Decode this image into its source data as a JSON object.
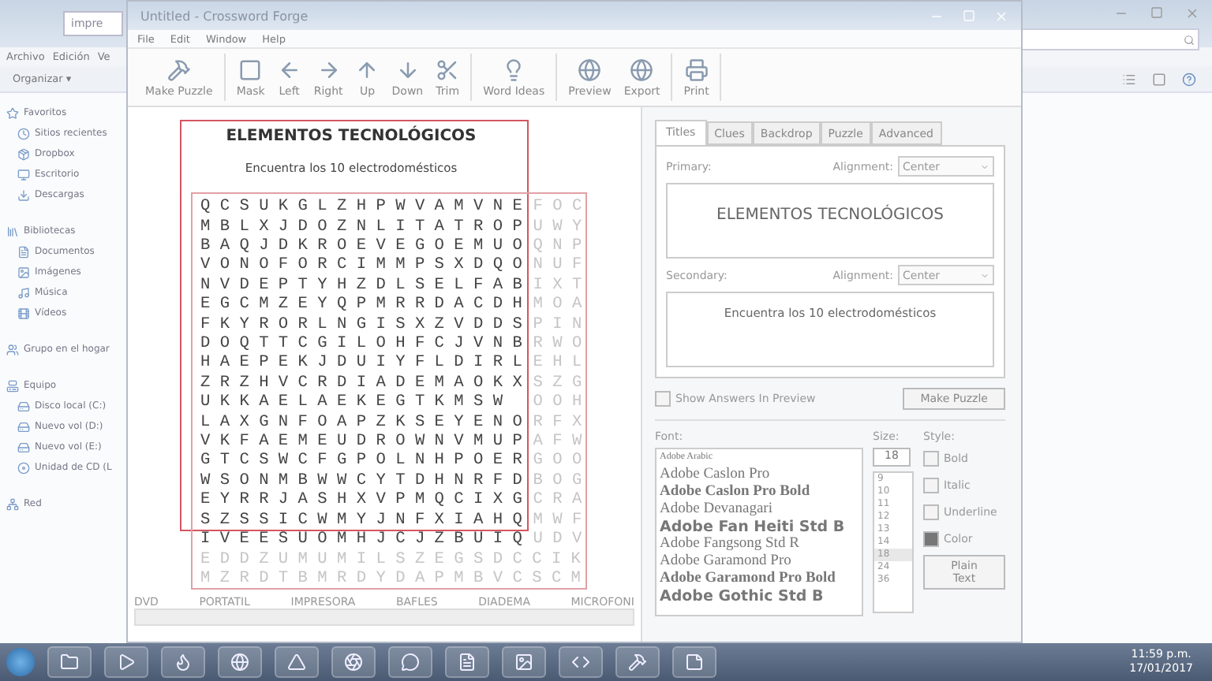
{
  "explorer": {
    "address": "impre",
    "menu": [
      "Archivo",
      "Edición",
      "Ve"
    ],
    "organize": "Organizar ▾",
    "sidebar": [
      {
        "kind": "star",
        "label": "Favoritos",
        "children": [
          {
            "kind": "clock",
            "label": "Sitios recientes"
          },
          {
            "kind": "box",
            "label": "Dropbox"
          },
          {
            "kind": "monitor",
            "label": "Escritorio"
          },
          {
            "kind": "download",
            "label": "Descargas"
          }
        ]
      },
      {
        "kind": "library",
        "label": "Bibliotecas",
        "children": [
          {
            "kind": "doc",
            "label": "Documentos"
          },
          {
            "kind": "image",
            "label": "Imágenes"
          },
          {
            "kind": "music",
            "label": "Música"
          },
          {
            "kind": "film",
            "label": "Vídeos"
          }
        ]
      },
      {
        "kind": "users",
        "label": "Grupo en el hogar"
      },
      {
        "kind": "computer",
        "label": "Equipo",
        "children": [
          {
            "kind": "drive",
            "label": "Disco local (C:)"
          },
          {
            "kind": "drive",
            "label": "Nuevo vol (D:)"
          },
          {
            "kind": "drive",
            "label": "Nuevo vol (E:)"
          },
          {
            "kind": "disc",
            "label": "Unidad de CD (L"
          }
        ]
      },
      {
        "kind": "network",
        "label": "Red"
      }
    ]
  },
  "window": {
    "title": "Untitled - Crossword Forge",
    "menu": [
      "File",
      "Edit",
      "Window",
      "Help"
    ],
    "toolbar": [
      [
        {
          "kind": "anvil",
          "label": "Make Puzzle"
        }
      ],
      [
        {
          "kind": "mask",
          "label": "Mask"
        },
        {
          "kind": "left",
          "label": "Left"
        },
        {
          "kind": "right",
          "label": "Right"
        },
        {
          "kind": "up",
          "label": "Up"
        },
        {
          "kind": "down",
          "label": "Down"
        },
        {
          "kind": "trim",
          "label": "Trim"
        }
      ],
      [
        {
          "kind": "bulb",
          "label": "Word Ideas"
        }
      ],
      [
        {
          "kind": "globe",
          "label": "Preview"
        },
        {
          "kind": "globe",
          "label": "Export"
        }
      ],
      [
        {
          "kind": "printer",
          "label": "Print"
        }
      ]
    ]
  },
  "puzzle": {
    "title": "ELEMENTOS TECNOLÓGICOS",
    "subtitle": "Encuentra los 10 electrodomésticos",
    "rows": [
      {
        "inside": "Q C S U K G L Z H P W V A M V N E",
        "outside": "F O C"
      },
      {
        "inside": "M B L X J D O Z N L I T A T R O P",
        "outside": "U W Y"
      },
      {
        "inside": "B A Q J D K R O E V E G O E M U O",
        "outside": "Q N P"
      },
      {
        "inside": "V O N O F O R C I M M P S X D Q O",
        "outside": "N U F"
      },
      {
        "inside": "N V D E P T Y H Z D L S E L F A B",
        "outside": "I X T"
      },
      {
        "inside": "E G C M Z E Y Q P M R R D A C D H",
        "outside": "M O A"
      },
      {
        "inside": "F K Y R O R L N G I S X Z V D D S",
        "outside": "P I N"
      },
      {
        "inside": "D O Q T T C G I L O H F C J V N B",
        "outside": "R W O"
      },
      {
        "inside": "H A E P E K J D U I Y F L D I R L",
        "outside": "E H L"
      },
      {
        "inside": "Z R Z H V C R D I A D E M A O K X",
        "outside": "S Z G"
      },
      {
        "inside": "U K K A E L A E K E G T K M S W",
        "outside": "O O H"
      },
      {
        "inside": "L A X G N F O A P Z K S E Y E N O",
        "outside": "R F X"
      },
      {
        "inside": "V K F A E M E U D R O W N V M U P",
        "outside": "A F W"
      },
      {
        "inside": "G T C S W C F G P O L N H P O E R",
        "outside": "G O O"
      },
      {
        "inside": "W S O N M B W W C Y T D H N R F D",
        "outside": "B O G"
      },
      {
        "inside": "E Y R R J A S H X V P M Q C I X G",
        "outside": "C R A"
      },
      {
        "inside": "S Z S S I C W M Y J N F X I A H Q",
        "outside": "M W F"
      },
      {
        "inside": "I V E E S U O M H J C J Z B U I Q",
        "outside": "U D V"
      }
    ],
    "outer_rows": [
      "E D D Z U M U M I L S Z E G S D C C I K",
      "M Z R D T B M R D Y D A P M B V C S C M"
    ],
    "words": [
      "DVD",
      "PORTATIL",
      "IMPRESORA",
      "BAFLES",
      "DIADEMA",
      "MICROFONI"
    ]
  },
  "settings": {
    "tabs": [
      {
        "label": "Titles",
        "selected": true
      },
      {
        "label": "Clues",
        "selected": false
      },
      {
        "label": "Backdrop",
        "selected": false
      },
      {
        "label": "Puzzle",
        "selected": false
      },
      {
        "label": "Advanced",
        "selected": false
      }
    ],
    "titles": [
      {
        "label": "Primary:",
        "alignment_label": "Alignment:",
        "alignment": "Center",
        "text": "ELEMENTOS TECNOLÓGICOS",
        "kind": "primary"
      },
      {
        "label": "Secondary:",
        "alignment_label": "Alignment:",
        "alignment": "Center",
        "text": "Encuentra los 10 electrodomésticos",
        "kind": "secondary"
      }
    ],
    "show_answers": {
      "label": "Show Answers In Preview",
      "checked": false
    },
    "make_puzzle": "Make Puzzle",
    "font_label": "Font:",
    "fonts": [
      {
        "name": "Adobe Arabic",
        "kind": "small-serif"
      },
      {
        "name": "Adobe Caslon Pro",
        "kind": "serif"
      },
      {
        "name": "Adobe Caslon Pro Bold",
        "kind": "serif-bold"
      },
      {
        "name": "Adobe Devanagari",
        "kind": "serif"
      },
      {
        "name": "Adobe Fan Heiti Std B",
        "kind": "sans-bold"
      },
      {
        "name": "Adobe Fangsong Std R",
        "kind": "serif"
      },
      {
        "name": "Adobe Garamond Pro",
        "kind": "serif"
      },
      {
        "name": "Adobe Garamond Pro Bold",
        "kind": "serif-bold"
      },
      {
        "name": "Adobe Gothic Std B",
        "kind": "sans-bold"
      }
    ],
    "size_label": "Size:",
    "size": "18",
    "sizes": [
      {
        "label": "9",
        "selected": false
      },
      {
        "label": "10",
        "selected": false
      },
      {
        "label": "11",
        "selected": false
      },
      {
        "label": "12",
        "selected": false
      },
      {
        "label": "13",
        "selected": false
      },
      {
        "label": "14",
        "selected": false
      },
      {
        "label": "18",
        "selected": true
      },
      {
        "label": "24",
        "selected": false
      },
      {
        "label": "36",
        "selected": false
      }
    ],
    "style_label": "Style:",
    "styles": [
      {
        "label": "Bold",
        "checked": false
      },
      {
        "label": "Italic",
        "checked": false
      },
      {
        "label": "Underline",
        "checked": false
      },
      {
        "label": "Color",
        "checked": true
      }
    ],
    "plain_text": "Plain Text"
  },
  "taskbar": {
    "time": "11:59 p.m.",
    "date": "17/01/2017"
  }
}
